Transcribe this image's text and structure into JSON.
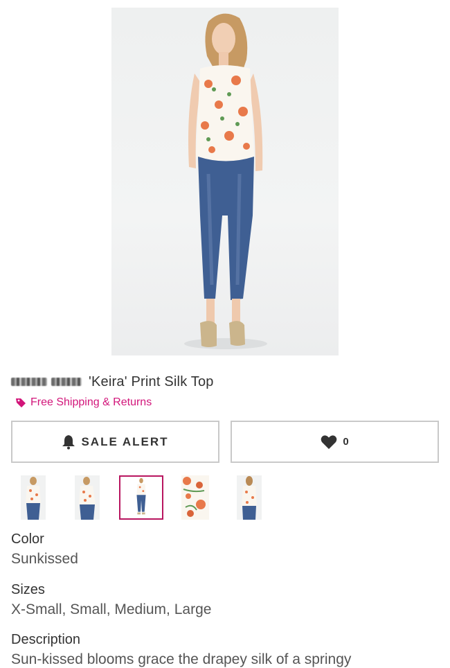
{
  "product": {
    "title": "'Keira' Print Silk Top",
    "brand_note": "brand name obscured",
    "shipping": "Free Shipping & Returns"
  },
  "actions": {
    "sale_alert_label": "SALE ALERT",
    "favorites_count": "0"
  },
  "thumbnails": [
    {
      "name": "thumb-front-view",
      "selected": false
    },
    {
      "name": "thumb-angled-view",
      "selected": false
    },
    {
      "name": "thumb-full-body-view",
      "selected": true
    },
    {
      "name": "thumb-print-detail",
      "selected": false
    },
    {
      "name": "thumb-back-view",
      "selected": false
    }
  ],
  "details": {
    "color_label": "Color",
    "color_value": "Sunkissed",
    "sizes_label": "Sizes",
    "sizes_value": "X-Small, Small, Medium, Large",
    "description_label": "Description",
    "description_text": "Sun-kissed blooms grace the drapey silk of a springy"
  },
  "colors": {
    "accent_pink": "#d2157a",
    "selected_border": "#b8155f",
    "button_border": "#c9c9c9"
  }
}
